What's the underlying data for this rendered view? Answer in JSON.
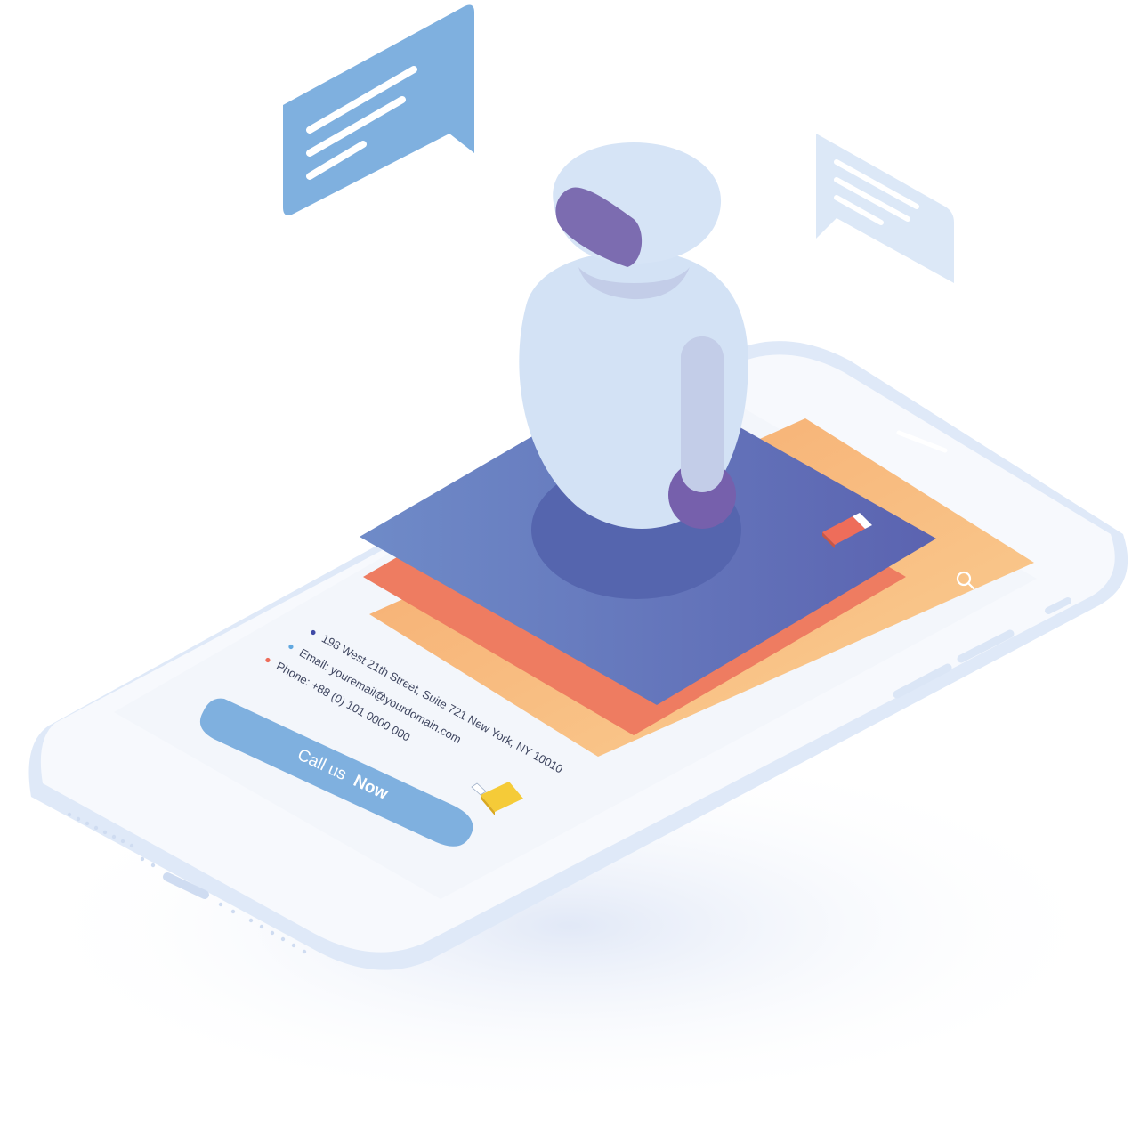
{
  "screen": {
    "contact_lines": [
      "198 West 21th Street, Suite 721 New York, NY 10010",
      "Email: youremail@yourdomain.com",
      "Phone: +88 (0) 101 0000 000"
    ],
    "cta": {
      "prefix": "Call us",
      "emphasis": "Now"
    }
  },
  "icons": {
    "search": "search-icon",
    "usb_red": "usb-drive-icon",
    "usb_yellow": "usb-drive-icon",
    "chat_left": "chat-bubble-icon",
    "chat_right": "chat-bubble-icon"
  },
  "colors": {
    "phone_frame": "#dfe9f8",
    "phone_body": "#f7f9fd",
    "screen": "#f3f6fb",
    "layer_yellow": "#f8c07e",
    "layer_orange": "#ee7c61",
    "layer_indigo": "#5f6db4",
    "robot_body": "#d3e2f5",
    "robot_visor": "#7c6cb0",
    "cta": "#7fb0df",
    "bubble_left": "#7fb0df",
    "bubble_right": "#dce8f7",
    "dot_indigo": "#3f4aa6",
    "dot_blue": "#61a8e0",
    "dot_red": "#ee6d5a"
  }
}
